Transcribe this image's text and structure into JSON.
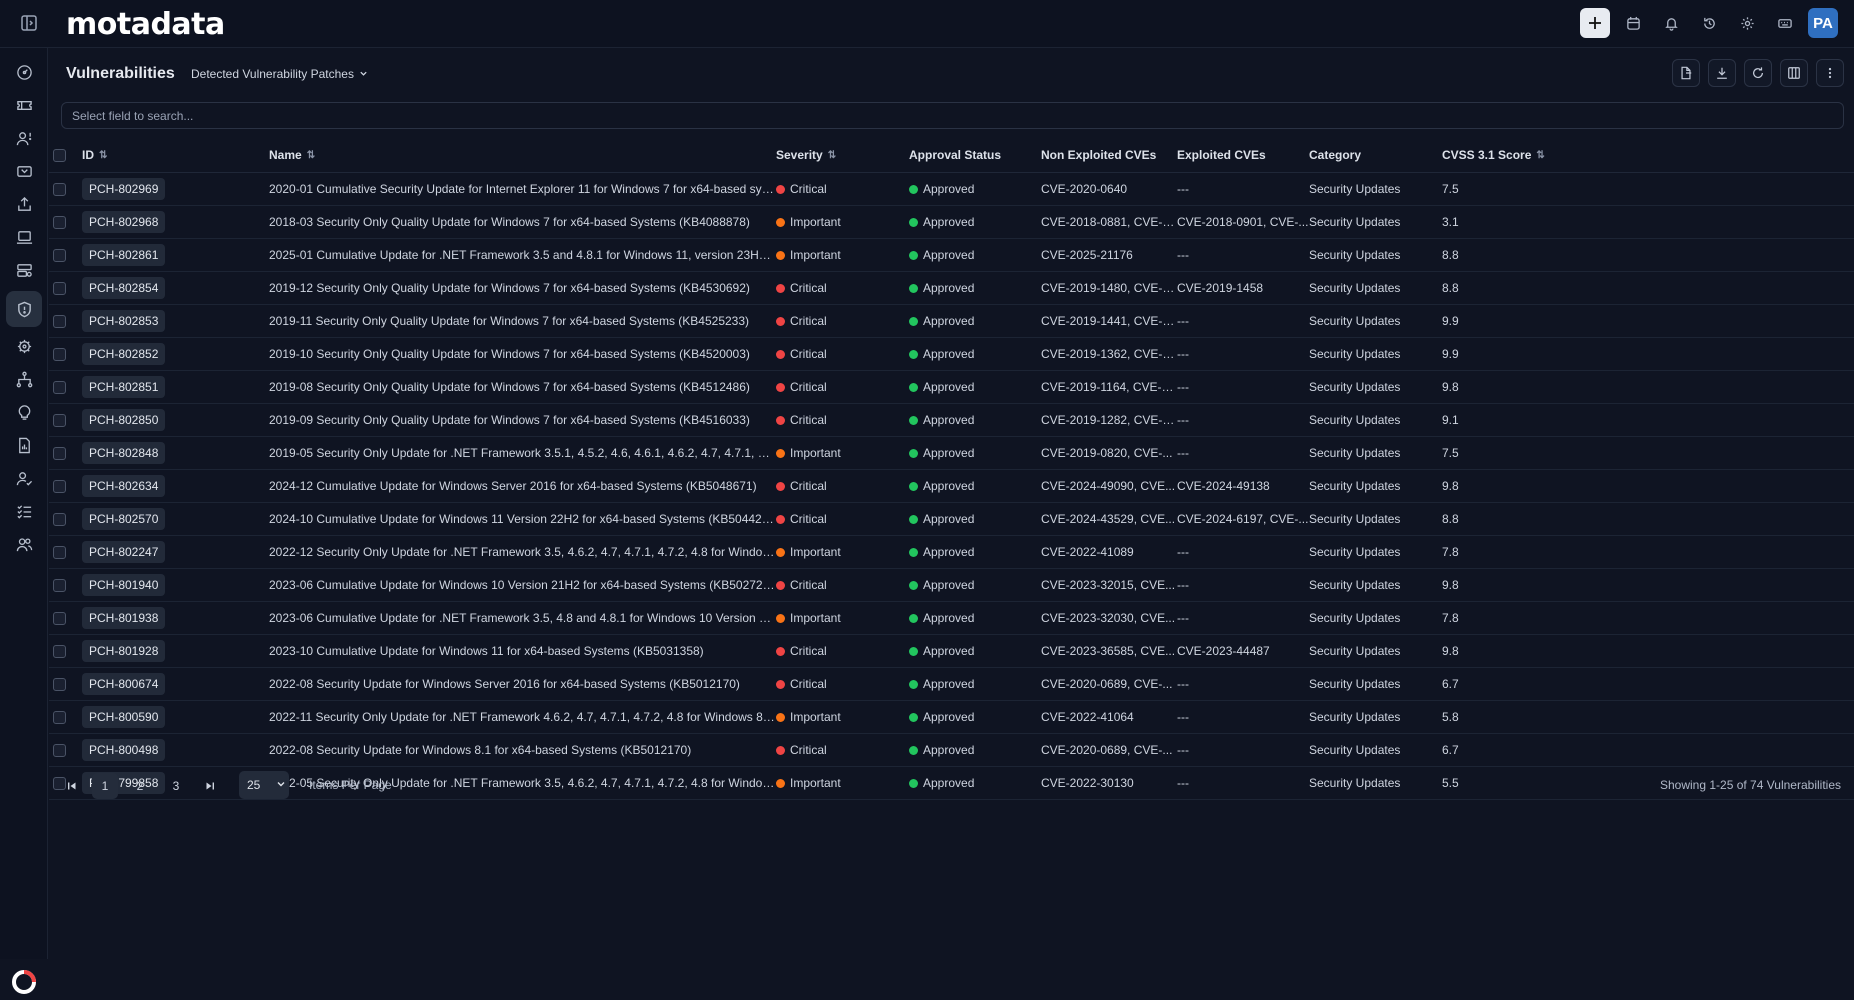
{
  "app": {
    "logo": "motadata",
    "avatar": "PA"
  },
  "page": {
    "title": "Vulnerabilities",
    "view": "Detected Vulnerability Patches"
  },
  "search": {
    "placeholder": "Select field to search..."
  },
  "columns": [
    "ID",
    "Name",
    "Severity",
    "Approval Status",
    "Non Exploited CVEs",
    "Exploited CVEs",
    "Category",
    "CVSS 3.1 Score"
  ],
  "colors": {
    "critical": "#ef4444",
    "important": "#f97316",
    "approved": "#22c55e",
    "accent": "#2f6fc0"
  },
  "rows": [
    {
      "id": "PCH-802969",
      "name": "2020-01 Cumulative Security Update for Internet Explorer 11 for Windows 7 for x64-based systems (...",
      "severity": "Critical",
      "approval": "Approved",
      "non_exploited": "CVE-2020-0640",
      "exploited": "---",
      "category": "Security Updates",
      "score": "7.5"
    },
    {
      "id": "PCH-802968",
      "name": "2018-03 Security Only Quality Update for Windows 7 for x64-based Systems (KB4088878)",
      "severity": "Important",
      "approval": "Approved",
      "non_exploited": "CVE-2018-0881, CVE-2...",
      "exploited": "CVE-2018-0901, CVE-...",
      "category": "Security Updates",
      "score": "3.1"
    },
    {
      "id": "PCH-802861",
      "name": "2025-01 Cumulative Update for .NET Framework 3.5 and 4.8.1 for Windows 11, version 23H2 for x64 (...",
      "severity": "Important",
      "approval": "Approved",
      "non_exploited": "CVE-2025-21176",
      "exploited": "---",
      "category": "Security Updates",
      "score": "8.8"
    },
    {
      "id": "PCH-802854",
      "name": "2019-12 Security Only Quality Update for Windows 7 for x64-based Systems (KB4530692)",
      "severity": "Critical",
      "approval": "Approved",
      "non_exploited": "CVE-2019-1480, CVE-2...",
      "exploited": "CVE-2019-1458",
      "category": "Security Updates",
      "score": "8.8"
    },
    {
      "id": "PCH-802853",
      "name": "2019-11 Security Only Quality Update for Windows 7 for x64-based Systems (KB4525233)",
      "severity": "Critical",
      "approval": "Approved",
      "non_exploited": "CVE-2019-1441, CVE-2...",
      "exploited": "---",
      "category": "Security Updates",
      "score": "9.9"
    },
    {
      "id": "PCH-802852",
      "name": "2019-10 Security Only Quality Update for Windows 7 for x64-based Systems (KB4520003)",
      "severity": "Critical",
      "approval": "Approved",
      "non_exploited": "CVE-2019-1362, CVE-2...",
      "exploited": "---",
      "category": "Security Updates",
      "score": "9.9"
    },
    {
      "id": "PCH-802851",
      "name": "2019-08 Security Only Quality Update for Windows 7 for x64-based Systems (KB4512486)",
      "severity": "Critical",
      "approval": "Approved",
      "non_exploited": "CVE-2019-1164, CVE-2...",
      "exploited": "---",
      "category": "Security Updates",
      "score": "9.8"
    },
    {
      "id": "PCH-802850",
      "name": "2019-09 Security Only Quality Update for Windows 7 for x64-based Systems (KB4516033)",
      "severity": "Critical",
      "approval": "Approved",
      "non_exploited": "CVE-2019-1282, CVE-2...",
      "exploited": "---",
      "category": "Security Updates",
      "score": "9.1"
    },
    {
      "id": "PCH-802848",
      "name": "2019-05 Security Only Update for .NET Framework 3.5.1, 4.5.2, 4.6, 4.6.1, 4.6.2, 4.7, 4.7.1, 4.7.2, 4.8 for...",
      "severity": "Important",
      "approval": "Approved",
      "non_exploited": "CVE-2019-0820, CVE-...",
      "exploited": "---",
      "category": "Security Updates",
      "score": "7.5"
    },
    {
      "id": "PCH-802634",
      "name": "2024-12 Cumulative Update for Windows Server 2016 for x64-based Systems (KB5048671)",
      "severity": "Critical",
      "approval": "Approved",
      "non_exploited": "CVE-2024-49090, CVE...",
      "exploited": "CVE-2024-49138",
      "category": "Security Updates",
      "score": "9.8"
    },
    {
      "id": "PCH-802570",
      "name": "2024-10 Cumulative Update for Windows 11 Version 22H2 for x64-based Systems (KB5044285)",
      "severity": "Critical",
      "approval": "Approved",
      "non_exploited": "CVE-2024-43529, CVE...",
      "exploited": "CVE-2024-6197, CVE-...",
      "category": "Security Updates",
      "score": "8.8"
    },
    {
      "id": "PCH-802247",
      "name": "2022-12 Security Only Update for .NET Framework 3.5, 4.6.2, 4.7, 4.7.1, 4.7.2, 4.8 for Windows 8.1 for ...",
      "severity": "Important",
      "approval": "Approved",
      "non_exploited": "CVE-2022-41089",
      "exploited": "---",
      "category": "Security Updates",
      "score": "7.8"
    },
    {
      "id": "PCH-801940",
      "name": "2023-06 Cumulative Update for Windows 10 Version 21H2 for x64-based Systems (KB5027215)",
      "severity": "Critical",
      "approval": "Approved",
      "non_exploited": "CVE-2023-32015, CVE...",
      "exploited": "---",
      "category": "Security Updates",
      "score": "9.8"
    },
    {
      "id": "PCH-801938",
      "name": "2023-06 Cumulative Update for .NET Framework 3.5, 4.8 and 4.8.1 for Windows 10 Version 21H2 for ...",
      "severity": "Important",
      "approval": "Approved",
      "non_exploited": "CVE-2023-32030, CVE...",
      "exploited": "---",
      "category": "Security Updates",
      "score": "7.8"
    },
    {
      "id": "PCH-801928",
      "name": "2023-10 Cumulative Update for Windows 11 for x64-based Systems (KB5031358)",
      "severity": "Critical",
      "approval": "Approved",
      "non_exploited": "CVE-2023-36585, CVE...",
      "exploited": "CVE-2023-44487",
      "category": "Security Updates",
      "score": "9.8"
    },
    {
      "id": "PCH-800674",
      "name": "2022-08 Security Update for Windows Server 2016 for x64-based Systems (KB5012170)",
      "severity": "Critical",
      "approval": "Approved",
      "non_exploited": "CVE-2020-0689, CVE-...",
      "exploited": "---",
      "category": "Security Updates",
      "score": "6.7"
    },
    {
      "id": "PCH-800590",
      "name": "2022-11 Security Only Update for .NET Framework 4.6.2, 4.7, 4.7.1, 4.7.2, 4.8 for Windows 8.1 for x64 (...",
      "severity": "Important",
      "approval": "Approved",
      "non_exploited": "CVE-2022-41064",
      "exploited": "---",
      "category": "Security Updates",
      "score": "5.8"
    },
    {
      "id": "PCH-800498",
      "name": "2022-08 Security Update for Windows 8.1 for x64-based Systems (KB5012170)",
      "severity": "Critical",
      "approval": "Approved",
      "non_exploited": "CVE-2020-0689, CVE-...",
      "exploited": "---",
      "category": "Security Updates",
      "score": "6.7"
    },
    {
      "id": "PCH-799858",
      "name": "2022-05 Security Only Update for .NET Framework 3.5, 4.6.2, 4.7, 4.7.1, 4.7.2, 4.8 for Windows 8.1 for...",
      "severity": "Important",
      "approval": "Approved",
      "non_exploited": "CVE-2022-30130",
      "exploited": "---",
      "category": "Security Updates",
      "score": "5.5"
    }
  ],
  "pagination": {
    "pages": [
      "1",
      "2",
      "3"
    ],
    "current": "1",
    "per_page": "25",
    "per_page_label": "Items Per Page",
    "summary": "Showing 1-25 of 74 Vulnerabilities"
  }
}
